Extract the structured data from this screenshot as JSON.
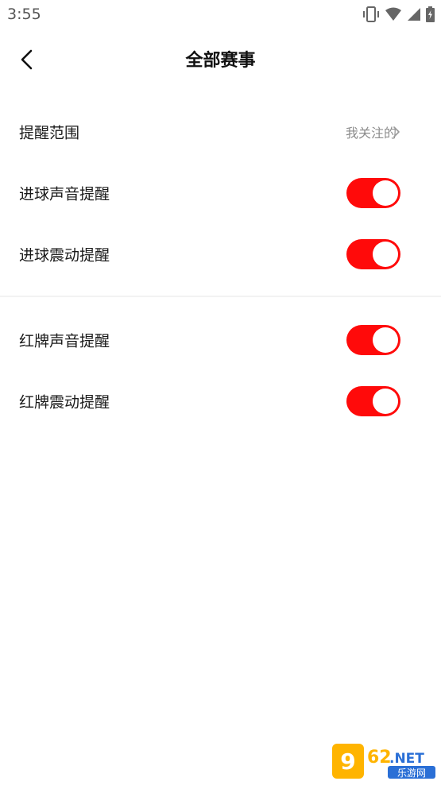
{
  "status_bar": {
    "time": "3:55",
    "icons": [
      "vibrate-icon",
      "wifi-icon",
      "signal-icon",
      "battery-icon"
    ]
  },
  "header": {
    "title": "全部赛事",
    "back_icon": "chevron-left-icon"
  },
  "settings": {
    "scope": {
      "label": "提醒范围",
      "value": "我关注的"
    },
    "goal_sound": {
      "label": "进球声音提醒",
      "enabled": true
    },
    "goal_vibrate": {
      "label": "进球震动提醒",
      "enabled": true
    },
    "red_card_sound": {
      "label": "红牌声音提醒",
      "enabled": true
    },
    "red_card_vibrate": {
      "label": "红牌震动提醒",
      "enabled": true
    }
  },
  "colors": {
    "toggle_on": "#ff0a0a",
    "secondary_text": "#8c8c8c"
  },
  "watermark": {
    "brand": "962.NET",
    "subtitle": "乐游网"
  }
}
